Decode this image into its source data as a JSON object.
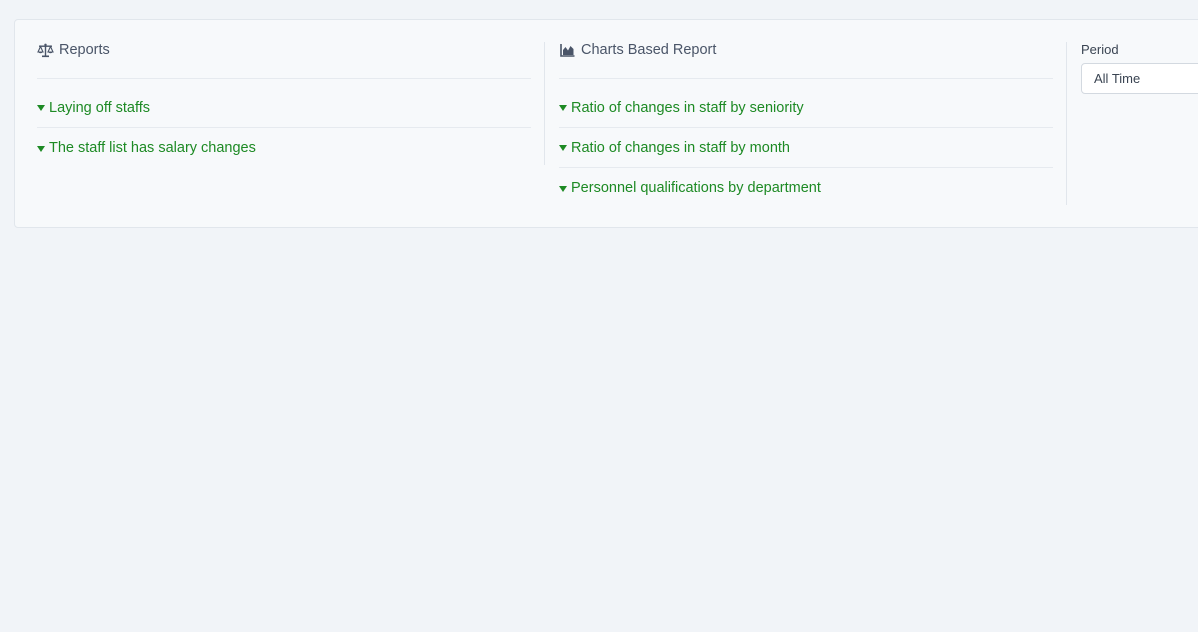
{
  "reports": {
    "title": "Reports",
    "icon": "scale-icon",
    "items": [
      {
        "label": "Laying off staffs"
      },
      {
        "label": "The staff list has salary changes"
      }
    ]
  },
  "charts": {
    "title": "Charts Based Report",
    "icon": "area-chart-icon",
    "items": [
      {
        "label": "Ratio of changes in staff by seniority"
      },
      {
        "label": "Ratio of changes in staff by month"
      },
      {
        "label": "Personnel qualifications by department"
      }
    ]
  },
  "period": {
    "label": "Period",
    "selected": "All Time"
  },
  "colors": {
    "link": "#1d8a24",
    "background": "#f1f4f8",
    "panel": "#f7f9fb"
  }
}
